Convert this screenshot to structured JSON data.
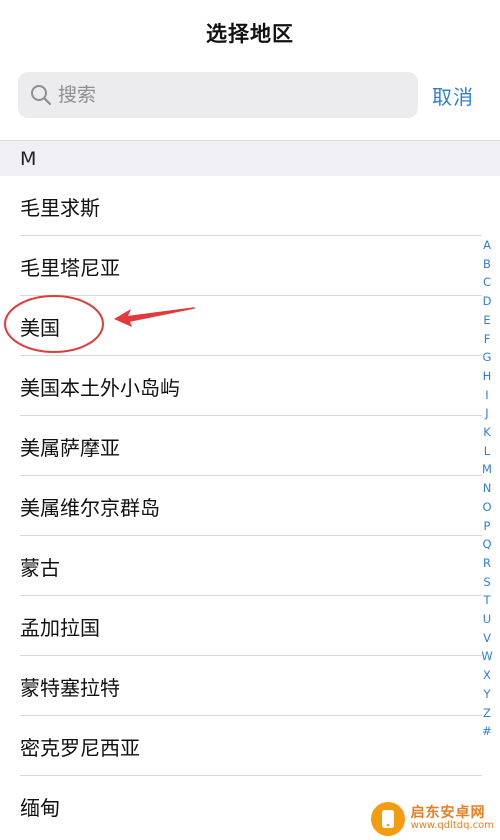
{
  "header": {
    "title": "选择地区"
  },
  "search": {
    "placeholder": "搜索",
    "value": ""
  },
  "cancel_label": "取消",
  "section": {
    "letter": "M"
  },
  "regions": [
    "毛里求斯",
    "毛里塔尼亚",
    "美国",
    "美国本土外小岛屿",
    "美属萨摩亚",
    "美属维尔京群岛",
    "蒙古",
    "孟加拉国",
    "蒙特塞拉特",
    "密克罗尼西亚",
    "缅甸"
  ],
  "index_letters": [
    "A",
    "B",
    "C",
    "D",
    "E",
    "F",
    "G",
    "H",
    "I",
    "J",
    "K",
    "L",
    "M",
    "N",
    "O",
    "P",
    "Q",
    "R",
    "S",
    "T",
    "U",
    "V",
    "W",
    "X",
    "Y",
    "Z",
    "#"
  ],
  "annotation": {
    "color": "#e23a3a",
    "highlighted_item": "美国"
  },
  "watermark": {
    "title": "启东安卓网",
    "url": "www.qdltdq.com"
  },
  "colors": {
    "accent": "#2f7fd6",
    "section_bg": "#efeff4",
    "search_bg": "#ececee"
  },
  "icons": {
    "search": "search-icon"
  }
}
